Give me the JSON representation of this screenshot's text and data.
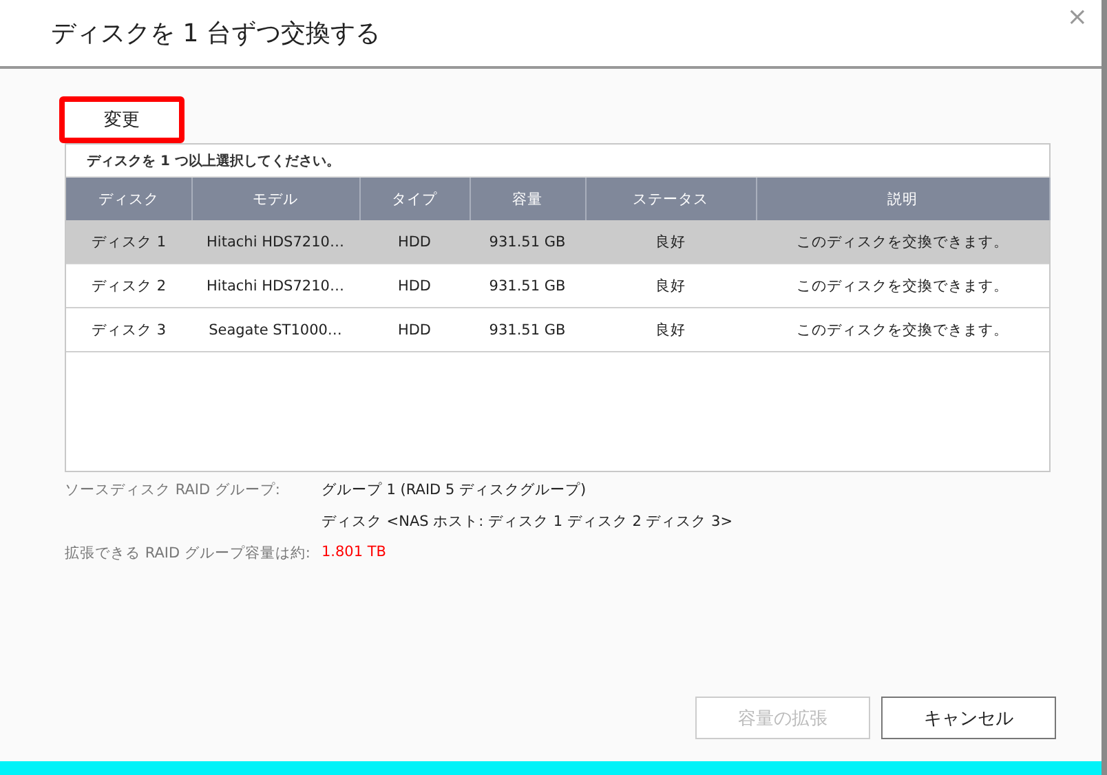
{
  "window": {
    "title": "ディスクを 1 台ずつ交換する",
    "close": "×"
  },
  "change_button": {
    "label": "変更",
    "highlighted": true
  },
  "table": {
    "caption": "ディスクを 1 つ以上選択してください。",
    "columns": [
      "ディスク",
      "モデル",
      "タイプ",
      "容量",
      "ステータス",
      "説明"
    ],
    "rows": [
      {
        "cells": [
          "ディスク 1",
          "Hitachi HDS7210…",
          "HDD",
          "931.51 GB",
          "良好",
          "このディスクを交換できます。"
        ],
        "selected": true
      },
      {
        "cells": [
          "ディスク 2",
          "Hitachi HDS7210…",
          "HDD",
          "931.51 GB",
          "良好",
          "このディスクを交換できます。"
        ],
        "selected": false
      },
      {
        "cells": [
          "ディスク 3",
          "Seagate ST1000…",
          "HDD",
          "931.51 GB",
          "良好",
          "このディスクを交換できます。"
        ],
        "selected": false
      }
    ]
  },
  "info": [
    {
      "label": "ソースディスク RAID グループ:",
      "value": "グループ 1 (RAID 5 ディスクグループ)",
      "highlight": false
    },
    {
      "value": "ディスク <NAS ホスト: ディスク 1 ディスク 2 ディスク 3>",
      "highlight": false
    },
    {
      "label": "拡張できる RAID グループ容量は約:",
      "value": "1.801 TB",
      "highlight": true
    }
  ],
  "buttons": [
    {
      "label": "容量の拡張",
      "disabled": true
    },
    {
      "label": "キャンセル",
      "disabled": false
    }
  ]
}
